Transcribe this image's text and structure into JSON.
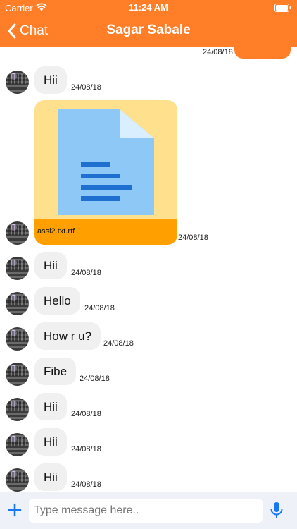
{
  "status_bar": {
    "carrier": "Carrier",
    "time": "11:24 AM"
  },
  "nav": {
    "back_label": "Chat",
    "title": "Sagar Sabale"
  },
  "sent_message": {
    "time": "24/08/18"
  },
  "file_message": {
    "file_name": "assi2.txt.rtf",
    "time": "24/08/18"
  },
  "messages": [
    {
      "text": "Hii",
      "time": "24/08/18"
    },
    {
      "text": "Hii",
      "time": "24/08/18"
    },
    {
      "text": "Hello",
      "time": "24/08/18"
    },
    {
      "text": "How r u?",
      "time": "24/08/18"
    },
    {
      "text": "Fibe",
      "time": "24/08/18"
    },
    {
      "text": "Hii",
      "time": "24/08/18"
    },
    {
      "text": "Hii",
      "time": "24/08/18"
    },
    {
      "text": "Hii",
      "time": "24/08/18"
    }
  ],
  "composer": {
    "placeholder": "Type message here.."
  },
  "colors": {
    "accent": "#FF7E27",
    "bubble": "#F0F0F0",
    "file_card": "#FFE08D",
    "file_footer": "#FF9F00",
    "input_bar": "#EEF1F8",
    "icon_blue": "#1878F0"
  },
  "icons": {
    "wifi": "wifi-icon",
    "battery": "battery-icon",
    "back": "chevron-left-icon",
    "add": "plus-icon",
    "mic": "microphone-icon",
    "avatar": "avatar"
  }
}
